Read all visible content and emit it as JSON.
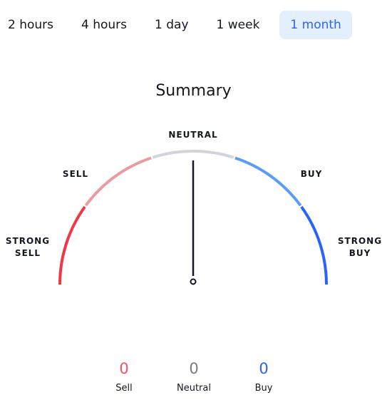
{
  "tabs": [
    {
      "label": "2 hours",
      "active": false
    },
    {
      "label": "4 hours",
      "active": false
    },
    {
      "label": "1 day",
      "active": false
    },
    {
      "label": "1 week",
      "active": false
    },
    {
      "label": "1 month",
      "active": true
    }
  ],
  "title": "Summary",
  "gauge": {
    "labels": {
      "strong_sell_1": "STRONG",
      "strong_sell_2": "SELL",
      "sell": "SELL",
      "neutral": "NEUTRAL",
      "buy": "BUY",
      "strong_buy_1": "STRONG",
      "strong_buy_2": "BUY"
    },
    "segments": [
      {
        "name": "strong-sell",
        "color": "#f23645"
      },
      {
        "name": "sell",
        "color": "#eb9a9f"
      },
      {
        "name": "neutral",
        "color": "#d1d4dc"
      },
      {
        "name": "buy",
        "color": "#5b9cf6"
      },
      {
        "name": "strong-buy",
        "color": "#2962ff"
      }
    ],
    "needle_value": 0.5
  },
  "counts": [
    {
      "value": "0",
      "label": "Sell",
      "color": "#f7525f"
    },
    {
      "value": "0",
      "label": "Neutral",
      "color": "#787b86"
    },
    {
      "value": "0",
      "label": "Buy",
      "color": "#2962ff"
    }
  ]
}
